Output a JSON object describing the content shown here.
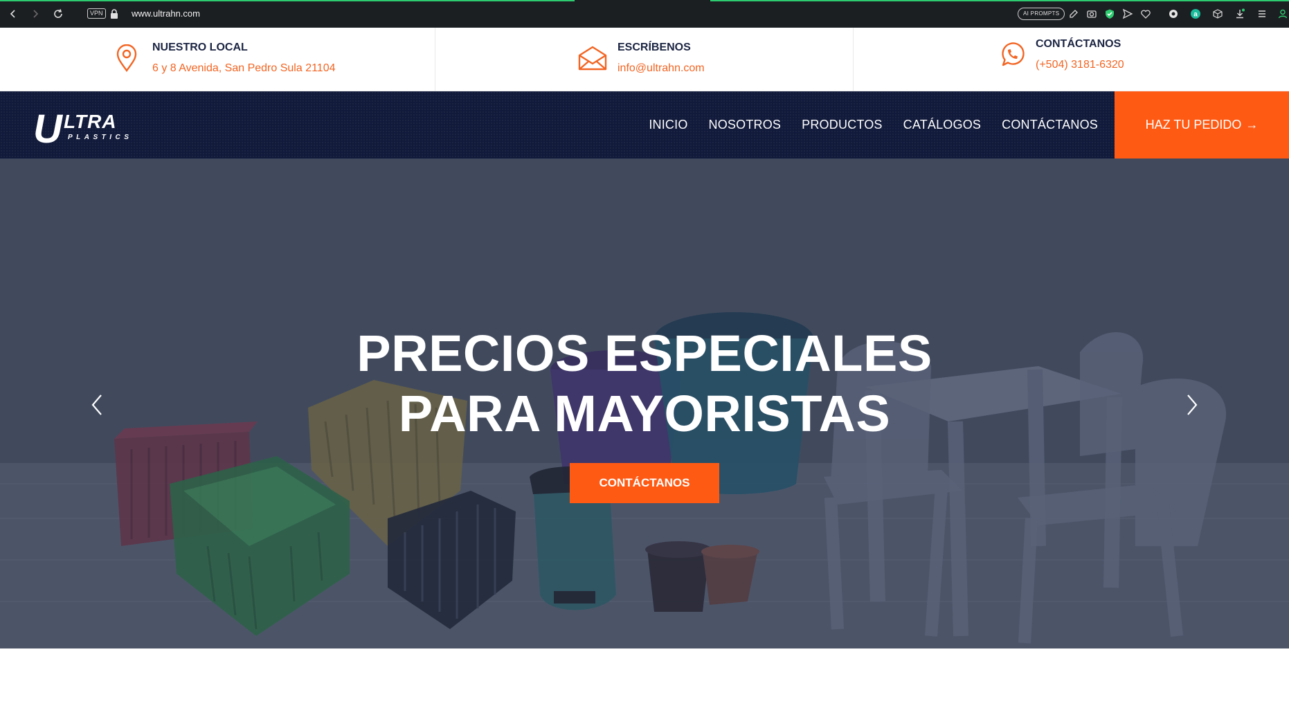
{
  "browser": {
    "url": "www.ultrahn.com",
    "vpn_label": "VPN",
    "ai_prompts_label": "AI PROMPTS",
    "extension_icons": [
      "edit-icon",
      "camera-icon",
      "shield-check-icon",
      "send-icon",
      "heart-icon",
      "extension-puzzle-icon",
      "account-a-icon",
      "cube-icon",
      "download-icon",
      "menu-lines-icon",
      "profile-icon"
    ]
  },
  "info_bar": {
    "location": {
      "title": "NUESTRO LOCAL",
      "value": "6 y 8 Avenida, San Pedro Sula 21104",
      "icon": "map-pin-icon"
    },
    "email": {
      "title": "ESCRÍBENOS",
      "value": "info@ultrahn.com",
      "icon": "envelope-icon"
    },
    "phone": {
      "title": "CONTÁCTANOS",
      "value": "(+504) 3181-6320",
      "icon": "whatsapp-icon"
    }
  },
  "navbar": {
    "logo_word": "LTRA",
    "logo_letter": "U",
    "logo_sub": "PLASTICS",
    "links": [
      "INICIO",
      "NOSOTROS",
      "PRODUCTOS",
      "CATÁLOGOS",
      "CONTÁCTANOS"
    ],
    "order_button": "HAZ TU PEDIDO",
    "order_arrow": "→"
  },
  "hero": {
    "title_line1": "PRECIOS ESPECIALES",
    "title_line2": "PARA MAYORISTAS",
    "cta_label": "CONTÁCTANOS"
  },
  "colors": {
    "accent": "#ff5a14",
    "navy": "#111a3a",
    "title_text": "#1b2442",
    "info_orange": "#f26422"
  }
}
